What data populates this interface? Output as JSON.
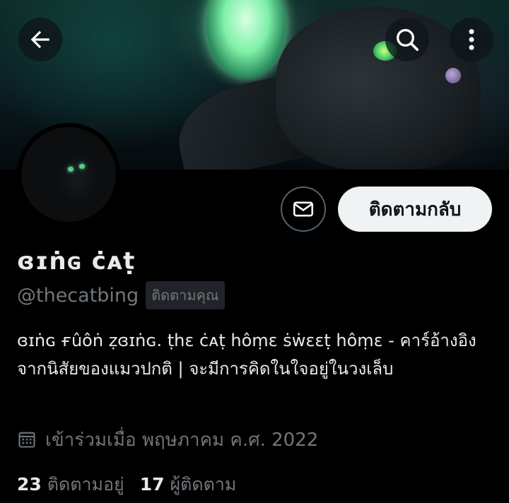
{
  "header": {
    "back_icon": "arrow-left-icon",
    "search_icon": "search-icon",
    "more_icon": "more-vertical-icon"
  },
  "profile": {
    "display_name": "ɞɪṅɢ ċᴀṭ",
    "handle": "@thecatbing",
    "follows_you_badge": "ติดตามคุณ",
    "bio": "ɞɪṅɢ ғûôṅ ẓɞɪṅɢ. ṭhɛ ċᴀṭ hôṃɛ ṡẇɛɛṭ hôṃɛ - คาร์อ้างอิงจากนิสัยของแมวปกติ | จะมีการคิดในใจอยู่ในวงเล็บ",
    "joined": "เข้าร่วมเมื่อ พฤษภาคม ค.ศ. 2022",
    "following_count": "23",
    "following_label": "ติดตามอยู่",
    "followers_count": "17",
    "followers_label": "ผู้ติดตาม"
  },
  "actions": {
    "message_icon": "mail-icon",
    "follow_back_label": "ติดตามกลับ"
  },
  "colors": {
    "background": "#000000",
    "text_primary": "#e7e9ea",
    "text_secondary": "#71767b",
    "button_light": "#eff3f4",
    "border": "#536471"
  }
}
